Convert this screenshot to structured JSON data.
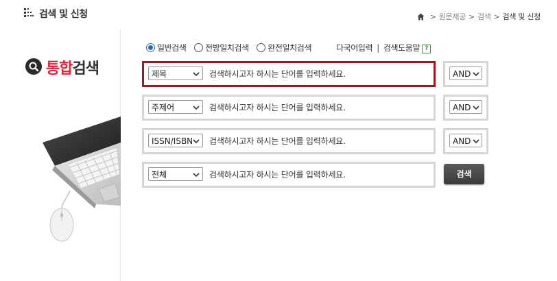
{
  "header": {
    "title": "검색 및 신청",
    "breadcrumb": [
      "원문제공",
      "검색",
      "검색 및 신청"
    ]
  },
  "brand": {
    "red_text": "통합",
    "dark_text": "검색"
  },
  "search_options": {
    "modes": [
      {
        "label": "일반검색",
        "selected": true
      },
      {
        "label": "전방일치검색",
        "selected": false
      },
      {
        "label": "완전일치검색",
        "selected": false
      }
    ],
    "multilang_link": "다국어입력",
    "help_link": "검색도움말",
    "help_icon_glyph": "?"
  },
  "rows": [
    {
      "field": "제목",
      "placeholder": "검색하시고자 하시는 단어를 입력하세요.",
      "operator": "AND"
    },
    {
      "field": "주제어",
      "placeholder": "검색하시고자 하시는 단어를 입력하세요.",
      "operator": "AND"
    },
    {
      "field": "ISSN/ISBN",
      "placeholder": "검색하시고자 하시는 단어를 입력하세요.",
      "operator": "AND"
    },
    {
      "field": "전체",
      "placeholder": "검색하시고자 하시는 단어를 입력하세요."
    }
  ],
  "search_button": "검색",
  "colors": {
    "brand_red": "#e2243b",
    "active_border": "#a8141e",
    "radio_blue": "#2b68c4"
  }
}
